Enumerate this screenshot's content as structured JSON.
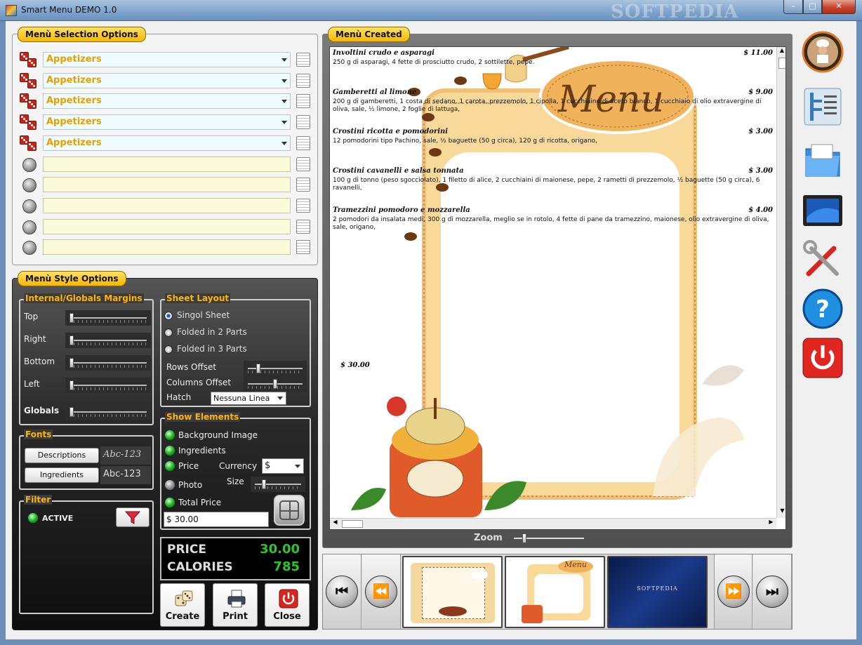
{
  "window": {
    "title": "Smart Menu DEMO 1.0",
    "watermark": "SOFTPEDIA",
    "min": "–",
    "max": "□",
    "close": "✕"
  },
  "selection": {
    "title": "Menù Selection Options",
    "rows": [
      {
        "value": "Appetizers",
        "filled": true
      },
      {
        "value": "Appetizers",
        "filled": true
      },
      {
        "value": "Appetizers",
        "filled": true
      },
      {
        "value": "Appetizers",
        "filled": true
      },
      {
        "value": "Appetizers",
        "filled": true
      },
      {
        "value": "",
        "filled": false
      },
      {
        "value": "",
        "filled": false
      },
      {
        "value": "",
        "filled": false
      },
      {
        "value": "",
        "filled": false
      },
      {
        "value": "",
        "filled": false
      }
    ]
  },
  "style": {
    "title": "Menù Style Options",
    "margins": {
      "title": "Internal/Globals Margins",
      "top": "Top",
      "right": "Right",
      "bottom": "Bottom",
      "left": "Left",
      "globals": "Globals"
    },
    "layout": {
      "title": "Sheet Layout",
      "singol": "Singol Sheet",
      "folded2": "Folded in 2 Parts",
      "folded3": "Folded in 3 Parts",
      "rows_offset": "Rows Offset",
      "cols_offset": "Columns Offset",
      "hatch": "Hatch",
      "hatch_value": "Nessuna Linea"
    },
    "fonts": {
      "title": "Fonts",
      "descriptions": "Descriptions",
      "ingredients": "Ingredients",
      "desc_preview": "Abc-123",
      "ingr_preview": "Abc-123"
    },
    "filter": {
      "title": "Filter",
      "status": "ACTIVE"
    },
    "show": {
      "title": "Show Elements",
      "background": "Background Image",
      "ingredients": "Ingredients",
      "price": "Price",
      "photo": "Photo",
      "total": "Total Price",
      "currency": "Currency",
      "currency_value": "$",
      "size": "Size",
      "total_value": "$ 30.00"
    },
    "totals": {
      "price_label": "PRICE",
      "price_value": "30.00",
      "cal_label": "CALORIES",
      "cal_value": "785"
    },
    "buttons": {
      "create": "Create",
      "print": "Print",
      "close": "Close"
    }
  },
  "menu": {
    "title": "Menù Created",
    "header_word": "Menu",
    "dishes": [
      {
        "name": "Involtini crudo e asparagi",
        "price": "$ 11.00",
        "desc": "250 g di asparagi, 4 fette di prosciutto crudo, 2 sottilette, pepe."
      },
      {
        "name": "Gamberetti al limone",
        "price": "$ 9.00",
        "desc": "200 g di gamberetti, 1 costa di sedano, 1 carota, prezzemolo, 1 cipolla, 1 cucchiaino di aceto bianco, 1 cucchiaio di olio extravergine di oliva, sale, ½ limone, 2 foglie di lattuga,"
      },
      {
        "name": "Crostini ricotta e pomodorini",
        "price": "$ 3.00",
        "desc": "12 pomodorini tipo Pachino, sale, ½ baguette (50 g circa), 120 g di ricotta, origano,"
      },
      {
        "name": "Crostini cavanelli e salsa tonnata",
        "price": "$ 3.00",
        "desc": "100 g di tonno (peso sgocciolato), 1 filetto di alice, 2 cucchiaini di maionese, pepe, 2 rametti di prezzemolo, ½ baguette (50 g circa), 6 ravanelli,"
      },
      {
        "name": "Tramezzini pomodoro e mozzarella",
        "price": "$ 4.00",
        "desc": "2 pomodori da insalata medi, 300 g di mozzarella, meglio se in rotolo, 4 fette di pane da tramezzino, maionese, olio extravergine di oliva, sale, origano,"
      }
    ],
    "total": "$ 30.00",
    "zoom_label": "Zoom"
  },
  "thumbs": {
    "softpedia": "SOFTPEDIA",
    "menu_word": "Menu"
  },
  "nav": {
    "first": "⏮",
    "prev": "⏪",
    "next": "⏩",
    "last": "⏭"
  }
}
